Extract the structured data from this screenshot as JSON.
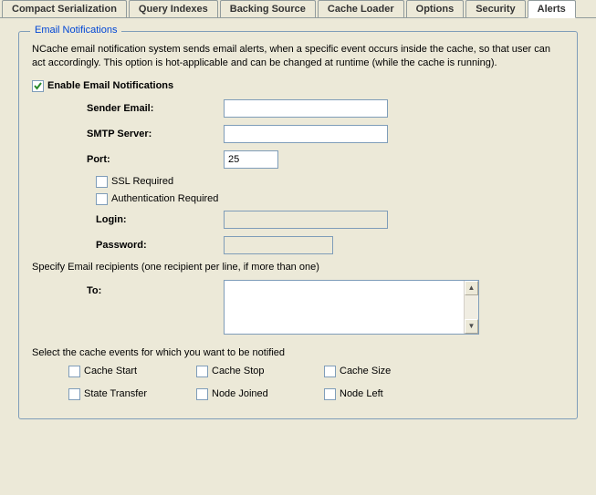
{
  "tabs": [
    "Compact Serialization",
    "Query Indexes",
    "Backing Source",
    "Cache Loader",
    "Options",
    "Security",
    "Alerts"
  ],
  "active_tab": 6,
  "group": {
    "title": "Email Notifications",
    "description": "NCache email notification system sends email alerts, when a specific event occurs inside the cache, so that user can act accordingly. This option is hot-applicable and can be changed at runtime (while the cache is running).",
    "enable_label": "Enable Email Notifications",
    "enable_checked": true
  },
  "fields": {
    "sender_label": "Sender Email:",
    "sender_value": "",
    "smtp_label": "SMTP Server:",
    "smtp_value": "",
    "port_label": "Port:",
    "port_value": "25",
    "ssl_label": "SSL Required",
    "ssl_checked": false,
    "auth_label": "Authentication Required",
    "auth_checked": false,
    "login_label": "Login:",
    "login_value": "",
    "password_label": "Password:",
    "password_value": ""
  },
  "recipients": {
    "caption": "Specify Email recipients (one recipient per line, if more than one)",
    "to_label": "To:",
    "to_value": ""
  },
  "events": {
    "caption": "Select the cache events for which you want to be notified",
    "items": [
      {
        "label": "Cache Start",
        "checked": false
      },
      {
        "label": "Cache Stop",
        "checked": false
      },
      {
        "label": "Cache Size",
        "checked": false
      },
      {
        "label": "State Transfer",
        "checked": false
      },
      {
        "label": "Node Joined",
        "checked": false
      },
      {
        "label": "Node Left",
        "checked": false
      }
    ]
  }
}
